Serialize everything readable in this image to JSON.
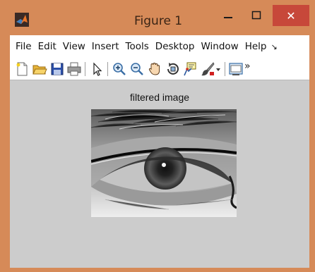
{
  "window": {
    "title": "Figure 1",
    "buttons": {
      "minimize": "–",
      "maximize": "□",
      "close": "✕"
    }
  },
  "menubar": {
    "items": [
      "File",
      "Edit",
      "View",
      "Insert",
      "Tools",
      "Desktop",
      "Window",
      "Help"
    ],
    "overflow_symbol": "↘"
  },
  "toolbar": {
    "tools": [
      {
        "icon": "new-figure-icon"
      },
      {
        "icon": "open-file-icon"
      },
      {
        "icon": "save-icon"
      },
      {
        "icon": "print-icon"
      },
      {
        "icon": "select-arrow-icon"
      },
      {
        "icon": "zoom-in-icon"
      },
      {
        "icon": "zoom-out-icon"
      },
      {
        "icon": "pan-hand-icon"
      },
      {
        "icon": "rotate-3d-icon"
      },
      {
        "icon": "data-cursor-icon"
      },
      {
        "icon": "brush-icon"
      },
      {
        "icon": "brush-dropdown-icon"
      },
      {
        "icon": "insert-colorbar-icon"
      },
      {
        "icon": "toolbar-overflow-icon"
      }
    ],
    "overflow_symbol": "»"
  },
  "figure": {
    "title": "filtered image",
    "image": "grayscale close-up of an eye"
  },
  "colors": {
    "window_frame": "#d68a58",
    "close_button": "#c7483a",
    "figure_background": "#cccccc"
  }
}
